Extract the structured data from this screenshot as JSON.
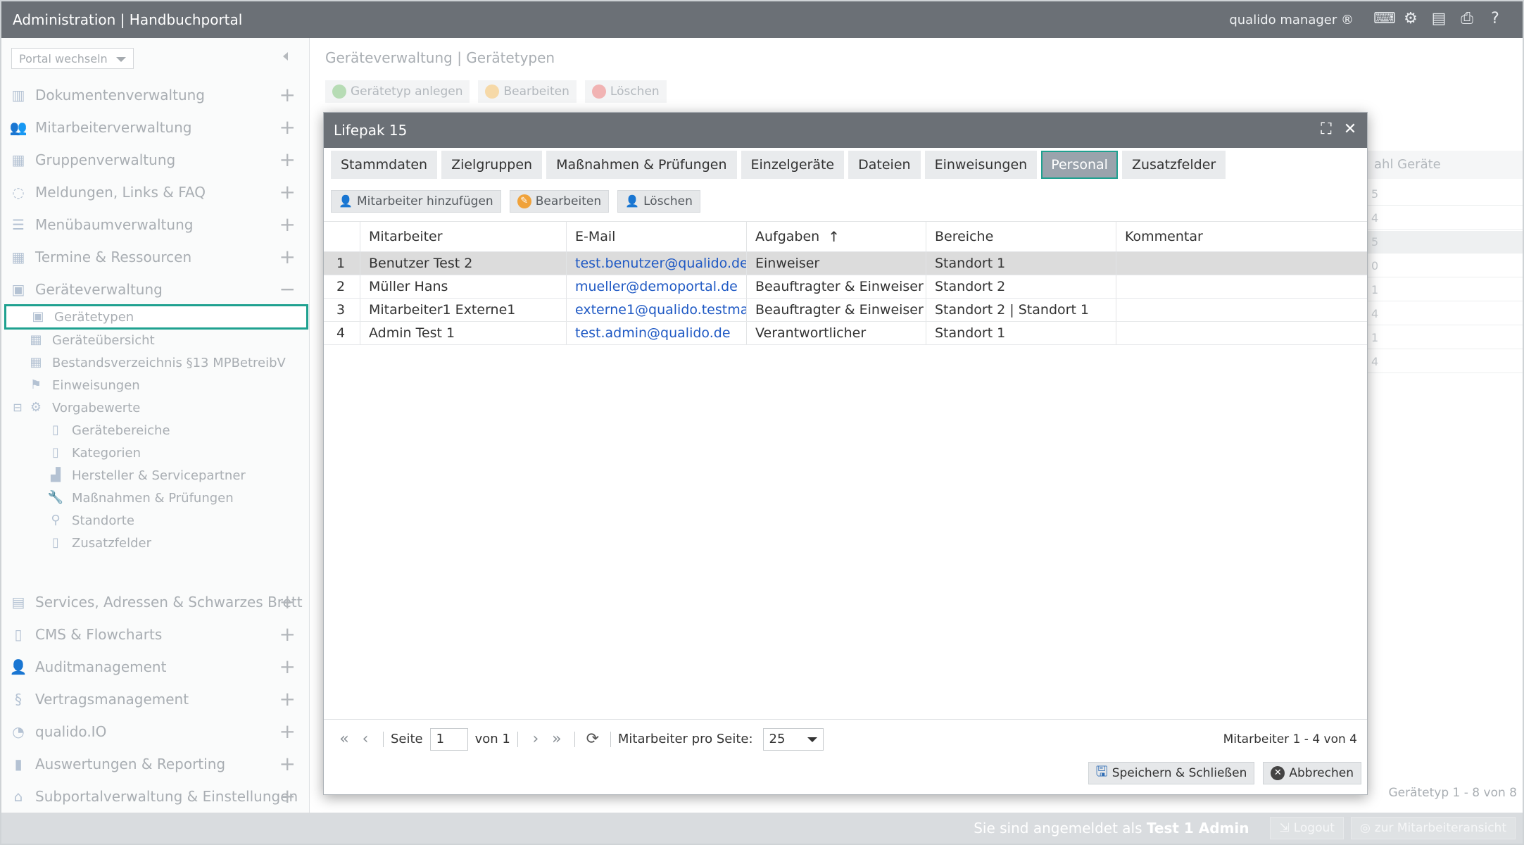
{
  "header": {
    "title": "Administration | Handbuchportal",
    "brand": "qualido manager ®",
    "icons": [
      "keyboard-icon",
      "settings-network-icon",
      "print-preview-icon",
      "print-icon",
      "help-icon"
    ]
  },
  "sidebar": {
    "portal_select": "Portal wechseln",
    "items": [
      {
        "label": "Dokumentenverwaltung",
        "icon": "documents-icon"
      },
      {
        "label": "Mitarbeiterverwaltung",
        "icon": "users-icon"
      },
      {
        "label": "Gruppenverwaltung",
        "icon": "groups-icon"
      },
      {
        "label": "Meldungen, Links & FAQ",
        "icon": "chat-icon"
      },
      {
        "label": "Menübaumverwaltung",
        "icon": "list-icon"
      },
      {
        "label": "Termine & Ressourcen",
        "icon": "calendar-icon"
      },
      {
        "label": "Geräteverwaltung",
        "icon": "devices-icon"
      }
    ],
    "sub_items": [
      {
        "label": "Gerätetypen",
        "icon": "device-type-icon"
      },
      {
        "label": "Geräteübersicht",
        "icon": "grid-icon"
      },
      {
        "label": "Bestandsverzeichnis §13 MPBetreibV",
        "icon": "grid-icon"
      },
      {
        "label": "Einweisungen",
        "icon": "instruction-icon"
      },
      {
        "label": "Vorgabewerte",
        "icon": "gears-icon"
      }
    ],
    "sub_sub_items": [
      {
        "label": "Gerätebereiche",
        "icon": "page-icon"
      },
      {
        "label": "Kategorien",
        "icon": "page-icon"
      },
      {
        "label": "Hersteller & Servicepartner",
        "icon": "factory-icon"
      },
      {
        "label": "Maßnahmen & Prüfungen",
        "icon": "wrench-icon"
      },
      {
        "label": "Standorte",
        "icon": "pin-icon"
      },
      {
        "label": "Zusatzfelder",
        "icon": "page-icon"
      }
    ],
    "bottom_items": [
      {
        "label": "Services, Adressen & Schwarzes Brett",
        "icon": "board-icon"
      },
      {
        "label": "CMS & Flowcharts",
        "icon": "cms-icon"
      },
      {
        "label": "Auditmanagement",
        "icon": "auditor-icon"
      },
      {
        "label": "Vertragsmanagement",
        "icon": "paragraph-icon"
      },
      {
        "label": "qualido.IO",
        "icon": "io-icon"
      },
      {
        "label": "Auswertungen & Reporting",
        "icon": "chart-icon"
      },
      {
        "label": "Subportalverwaltung & Einstellungen",
        "icon": "home-icon"
      }
    ]
  },
  "main": {
    "breadcrumb": "Geräteverwaltung | Gerätetypen",
    "toolbar": {
      "create": "Gerätetyp anlegen",
      "edit": "Bearbeiten",
      "delete": "Löschen"
    },
    "bg_column": "ahl Geräte",
    "bg_values": [
      "5",
      "4",
      "5",
      "0",
      "1",
      "4",
      "1",
      "4"
    ],
    "bg_count": "Gerätetyp 1 - 8 von 8"
  },
  "dialog": {
    "title": "Lifepak 15",
    "tabs": [
      "Stammdaten",
      "Zielgruppen",
      "Maßnahmen & Prüfungen",
      "Einzelgeräte",
      "Dateien",
      "Einweisungen",
      "Personal",
      "Zusatzfelder"
    ],
    "active_tab": "Personal",
    "toolbar": {
      "add": "Mitarbeiter hinzufügen",
      "edit": "Bearbeiten",
      "delete": "Löschen"
    },
    "columns": [
      "Mitarbeiter",
      "E-Mail",
      "Aufgaben",
      "Bereiche",
      "Kommentar"
    ],
    "rows": [
      {
        "n": "1",
        "name": "Benutzer Test 2",
        "email": "test.benutzer@qualido.de",
        "tasks": "Einweiser",
        "areas": "Standort 1",
        "comment": ""
      },
      {
        "n": "2",
        "name": "Müller Hans",
        "email": "mueller@demoportal.de",
        "tasks": "Beauftragter & Einweiser",
        "areas": "Standort 2",
        "comment": ""
      },
      {
        "n": "3",
        "name": "Mitarbeiter1 Externe1",
        "email": "externe1@qualido.testma...",
        "tasks": "Beauftragter & Einweiser",
        "areas": "Standort 2 | Standort 1",
        "comment": ""
      },
      {
        "n": "4",
        "name": "Admin Test 1",
        "email": "test.admin@qualido.de",
        "tasks": "Verantwortlicher",
        "areas": "Standort 1",
        "comment": ""
      }
    ],
    "pager": {
      "page_label": "Seite",
      "page_value": "1",
      "of_label": "von 1",
      "per_page_label": "Mitarbeiter pro Seite:",
      "per_page_value": "25",
      "count": "Mitarbeiter 1 - 4 von 4"
    },
    "actions": {
      "save": "Speichern & Schließen",
      "cancel": "Abbrechen"
    }
  },
  "status": {
    "login_prefix": "Sie sind angemeldet als",
    "login_user": "Test 1 Admin",
    "logout": "Logout",
    "staff_view": "zur Mitarbeiteransicht"
  }
}
